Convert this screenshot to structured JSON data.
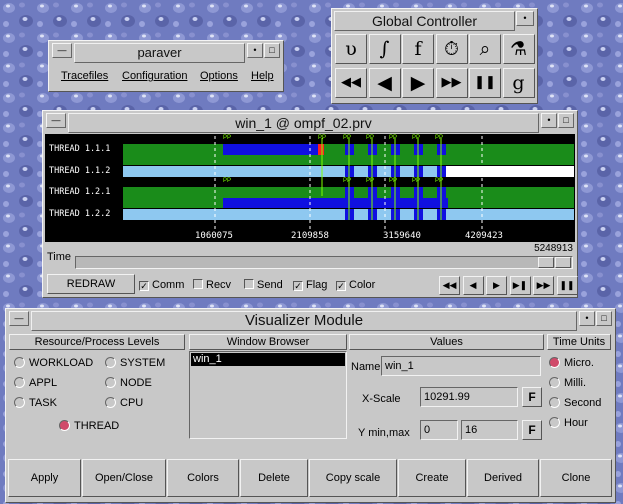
{
  "global_controller": {
    "title": "Global Controller",
    "top_icons": [
      "υ",
      "∫",
      "f",
      "⏱",
      "⌕",
      "⚗"
    ],
    "bottom_icons": [
      "◀◀",
      "◀",
      "▶",
      "▶▶",
      "❚❚",
      "g"
    ]
  },
  "paraver": {
    "title": "paraver",
    "menu": [
      "Tracefiles",
      "Configuration",
      "Options",
      "Help"
    ]
  },
  "timeline": {
    "title": "win_1 @ ompf_02.prv",
    "threads": [
      "THREAD 1.1.1",
      "THREAD 1.1.2",
      "THREAD 1.2.1",
      "THREAD 1.2.2"
    ],
    "ticks": [
      "1060075",
      "2109858",
      "3159640",
      "4209423"
    ],
    "time_label": "Time",
    "time_end": "5248913",
    "redraw": "REDRAW",
    "checks": [
      {
        "label": "Comm",
        "checked": true
      },
      {
        "label": "Recv",
        "checked": false
      },
      {
        "label": "Send",
        "checked": false
      },
      {
        "label": "Flag",
        "checked": true
      },
      {
        "label": "Color",
        "checked": true
      }
    ],
    "nav": [
      "◀◀",
      "◀",
      "▶",
      "▶❚",
      "▶▶",
      "❚❚"
    ],
    "colors": {
      "bg": "#000000",
      "green": "#1a8c1a",
      "blue": "#1010e0",
      "light_blue": "#8ec8f0",
      "white": "#ffffff",
      "flag": "#7fff00",
      "red": "#ff2020"
    }
  },
  "visualizer": {
    "title": "Visualizer Module",
    "levels_header": "Resource/Process Levels",
    "levels": [
      {
        "label": "WORKLOAD",
        "on": false
      },
      {
        "label": "SYSTEM",
        "on": false
      },
      {
        "label": "APPL",
        "on": false
      },
      {
        "label": "NODE",
        "on": false
      },
      {
        "label": "TASK",
        "on": false
      },
      {
        "label": "CPU",
        "on": false
      },
      {
        "label": "THREAD",
        "on": true
      }
    ],
    "browser_header": "Window Browser",
    "browser_items": [
      "win_1"
    ],
    "values_header": "Values",
    "name_label": "Name",
    "name_value": "win_1",
    "xscale_label": "X-Scale",
    "xscale_value": "10291.99",
    "ymm_label": "Y min,max",
    "ymin": "0",
    "ymax": "16",
    "f_label": "F",
    "units_header": "Time Units",
    "units": [
      {
        "label": "Micro.",
        "on": true
      },
      {
        "label": "Milli.",
        "on": false
      },
      {
        "label": "Second",
        "on": false
      },
      {
        "label": "Hour",
        "on": false
      }
    ],
    "buttons": [
      "Apply",
      "Open/Close",
      "Colors",
      "Delete",
      "Copy scale",
      "Create",
      "Derived",
      "Clone"
    ]
  }
}
